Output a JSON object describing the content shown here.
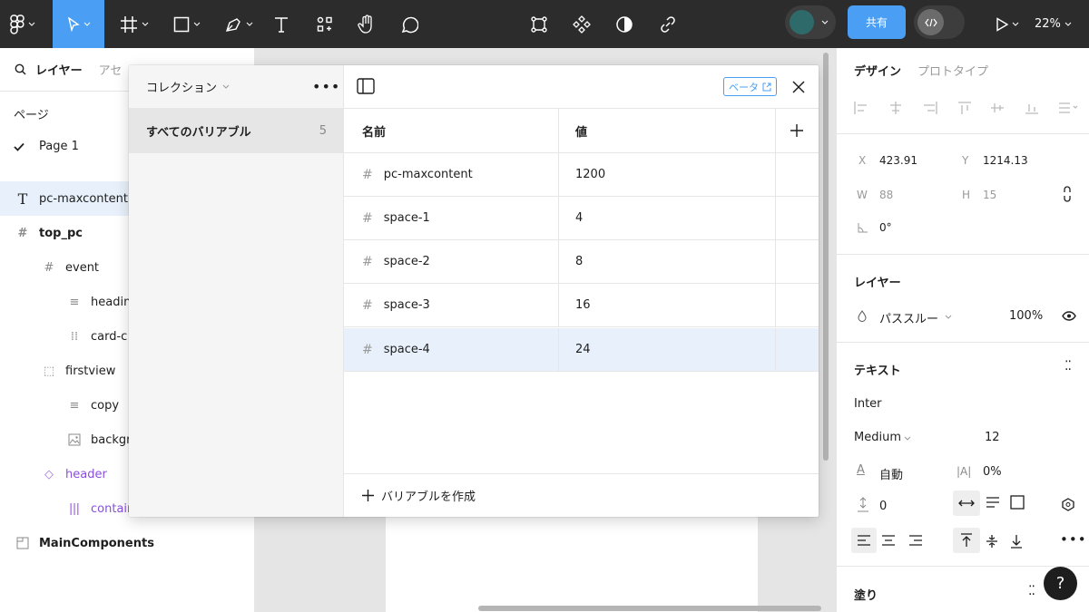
{
  "toolbar": {
    "share_label": "共有",
    "zoom": "22%"
  },
  "layers_panel": {
    "tab_layers": "レイヤー",
    "tab_assets": "アセ",
    "pages_header": "ページ",
    "page_item": "Page 1",
    "layers": [
      {
        "label": "pc-maxcontent",
        "icon": "text-icon",
        "selected": true
      },
      {
        "label": "top_pc",
        "icon": "frame-icon"
      },
      {
        "label": "event",
        "icon": "frame-icon"
      },
      {
        "label": "headin",
        "icon": "stack-icon"
      },
      {
        "label": "card-c",
        "icon": "grid-icon"
      },
      {
        "label": "firstview",
        "icon": "group-icon"
      },
      {
        "label": "copy",
        "icon": "stack-icon"
      },
      {
        "label": "backgr",
        "icon": "image-icon"
      },
      {
        "label": "header",
        "icon": "instance-icon"
      },
      {
        "label": "contair",
        "icon": "auto-layout-icon"
      },
      {
        "label": "MainComponents",
        "icon": "section-icon"
      }
    ]
  },
  "variables_modal": {
    "collections_header": "コレクション",
    "collection_name": "すべてのバリアブル",
    "collection_count": "5",
    "beta_label": "ベータ",
    "col_name": "名前",
    "col_value": "値",
    "rows": [
      {
        "name": "pc-maxcontent",
        "value": "1200"
      },
      {
        "name": "space-1",
        "value": "4"
      },
      {
        "name": "space-2",
        "value": "8"
      },
      {
        "name": "space-3",
        "value": "16"
      },
      {
        "name": "space-4",
        "value": "24",
        "selected": true
      }
    ],
    "create_label": "バリアブルを作成"
  },
  "design_panel": {
    "tab_design": "デザイン",
    "tab_prototype": "プロトタイプ",
    "x_label": "X",
    "x_value": "423.91",
    "y_label": "Y",
    "y_value": "1214.13",
    "w_label": "W",
    "w_value": "88",
    "h_label": "H",
    "h_value": "15",
    "rotation": "0°",
    "layer_section": "レイヤー",
    "blend_mode": "パススルー",
    "opacity": "100%",
    "text_section": "テキスト",
    "font_family": "Inter",
    "font_weight": "Medium",
    "font_size": "12",
    "line_height": "自動",
    "letter_spacing": "0%",
    "paragraph_spacing": "0",
    "fill_section": "塗り"
  },
  "colors": {
    "accent": "#4a9ff5",
    "toolbar_bg": "#2c2c2c",
    "selection_bg": "#e8f1fb",
    "component_purple": "#8a4fdd"
  }
}
